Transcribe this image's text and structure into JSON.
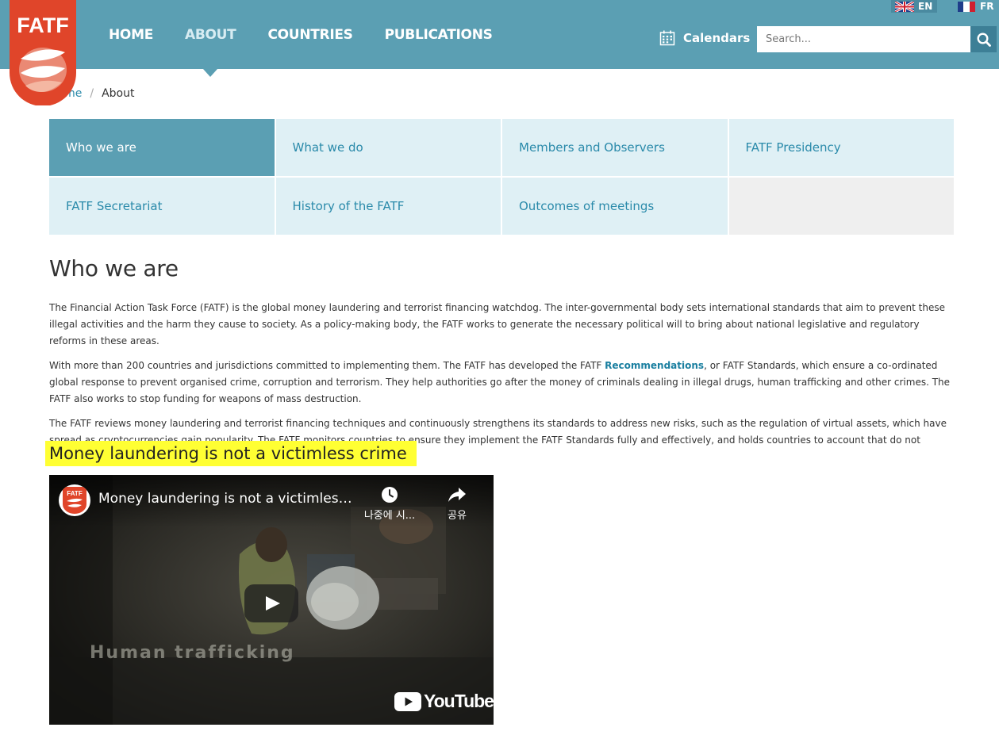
{
  "header": {
    "logo_text": "FATF",
    "nav": [
      {
        "label": "HOME"
      },
      {
        "label": "ABOUT"
      },
      {
        "label": "COUNTRIES"
      },
      {
        "label": "PUBLICATIONS"
      }
    ],
    "lang_en": "EN",
    "lang_fr": "FR",
    "calendars_label": "Calendars",
    "search_placeholder": "Search...",
    "search_icon": "magnifier-icon",
    "calendar_icon": "calendar-icon"
  },
  "breadcrumb": {
    "home": "Home",
    "separator": "/",
    "current": "About"
  },
  "submenu": [
    {
      "label": "Who we are"
    },
    {
      "label": "What we do"
    },
    {
      "label": "Members and Observers"
    },
    {
      "label": "FATF Presidency"
    },
    {
      "label": "FATF Secretariat"
    },
    {
      "label": "History of the FATF"
    },
    {
      "label": "Outcomes of meetings"
    }
  ],
  "page": {
    "title": "Who we are",
    "p1": "The Financial Action Task Force (FATF) is the global money laundering and terrorist financing watchdog. The inter-governmental body sets international standards that aim to prevent these illegal activities and the harm they cause to society. As a policy-making body, the FATF works to generate the necessary political will to bring about national legislative and regulatory reforms in these areas.",
    "p2_before": "With more than 200 countries and jurisdictions committed to implementing them.  The FATF has developed the FATF ",
    "p2_link": "Recommendations",
    "p2_after": ", or FATF Standards, which ensure a co-ordinated global response to prevent organised crime, corruption and terrorism. They help authorities go after the money of criminals dealing in illegal drugs, human trafficking and other crimes.  The FATF also works to stop funding for weapons of mass destruction.",
    "p3": "The FATF reviews money laundering and terrorist financing techniques and continuously strengthens its standards to address new risks, such as the regulation of virtual assets, which have spread as cryptocurrencies gain popularity.  The FATF monitors countries to ensure they implement the FATF Standards fully and effectively, and holds countries to account that do not comply.",
    "highlight_title": "Money laundering is not a victimless crime"
  },
  "video": {
    "title": "Money laundering is not a victimless crime",
    "watch_later": "나중에 시...",
    "share": "공유",
    "overlay_text": "Human  trafficking",
    "youtube_label": "YouTube",
    "channel_avatar_text": "FATF"
  },
  "colors": {
    "header_bg": "#5b9fb3",
    "logo_red": "#e0452a",
    "link": "#2a8aaa",
    "highlight": "#ffff33"
  }
}
